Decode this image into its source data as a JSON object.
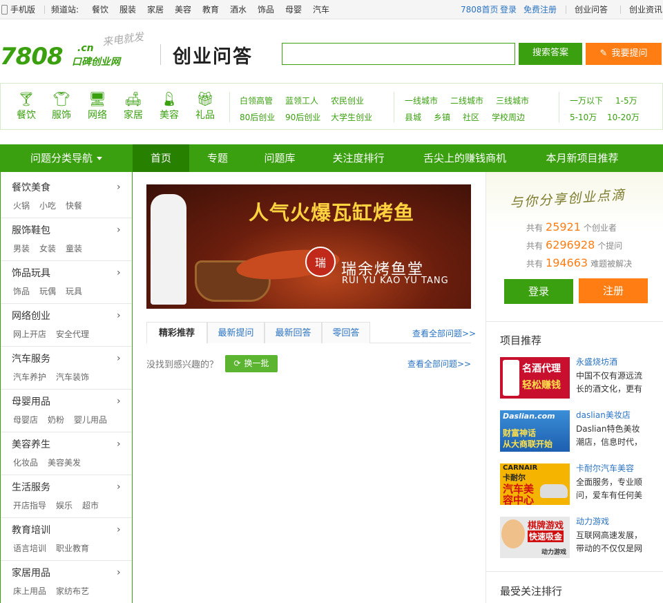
{
  "topbar": {
    "mobile": "手机版",
    "channel_label": "频道站:",
    "channels": [
      "餐饮",
      "服装",
      "家居",
      "美容",
      "教育",
      "酒水",
      "饰品",
      "母婴",
      "汽车"
    ],
    "home": "7808首页",
    "login": "登录",
    "register": "免费注册",
    "qa": "创业问答",
    "news": "创业资讯"
  },
  "header": {
    "logo_main": "7808",
    "logo_cn": ".cn",
    "logo_sub": "口碑创业网",
    "logo_slogan": "来电就发",
    "title": "创业问答",
    "search_button": "搜索答案",
    "ask_button": "我要提问"
  },
  "categories": {
    "icons": [
      {
        "label": "餐饮",
        "icon": "cocktail-icon"
      },
      {
        "label": "服饰",
        "icon": "tshirt-icon"
      },
      {
        "label": "网络",
        "icon": "monitor-icon"
      },
      {
        "label": "家居",
        "icon": "sofa-icon"
      },
      {
        "label": "美容",
        "icon": "lipstick-icon"
      },
      {
        "label": "礼品",
        "icon": "gift-icon"
      }
    ],
    "groups": [
      [
        "白领高管",
        "蓝领工人",
        "农民创业",
        "80后创业",
        "90后创业",
        "大学生创业"
      ],
      [
        "一线城市",
        "二线城市",
        "三线城市",
        "县城",
        "乡镇",
        "社区",
        "学校周边"
      ],
      [
        "一万以下",
        "1-5万",
        "5-10万",
        "10-20万"
      ]
    ]
  },
  "nav": {
    "category_nav": "问题分类导航",
    "items": [
      "首页",
      "专题",
      "问题库",
      "关注度排行",
      "舌尖上的赚钱商机",
      "本月新项目推荐"
    ]
  },
  "sidebar": [
    {
      "title": "餐饮美食",
      "subs": [
        "火锅",
        "小吃",
        "快餐"
      ]
    },
    {
      "title": "服饰鞋包",
      "subs": [
        "男装",
        "女装",
        "童装"
      ]
    },
    {
      "title": "饰品玩具",
      "subs": [
        "饰品",
        "玩偶",
        "玩具"
      ]
    },
    {
      "title": "网络创业",
      "subs": [
        "网上开店",
        "安全代理"
      ]
    },
    {
      "title": "汽车服务",
      "subs": [
        "汽车养护",
        "汽车装饰"
      ]
    },
    {
      "title": "母婴用品",
      "subs": [
        "母婴店",
        "奶粉",
        "婴儿用品"
      ]
    },
    {
      "title": "美容养生",
      "subs": [
        "化妆品",
        "美容美发"
      ]
    },
    {
      "title": "生活服务",
      "subs": [
        "开店指导",
        "娱乐",
        "超市"
      ]
    },
    {
      "title": "教育培训",
      "subs": [
        "语言培训",
        "职业教育"
      ]
    },
    {
      "title": "家居用品",
      "subs": [
        "床上用品",
        "家纺布艺"
      ]
    }
  ],
  "banner": {
    "headline": "人气火爆瓦缸烤鱼",
    "brand": "瑞余烤鱼堂",
    "pinyin": "RUI YU KAO YU TANG",
    "seal": "瑞"
  },
  "tabs": {
    "items": [
      "精彩推荐",
      "最新提问",
      "最新回答",
      "零回答"
    ],
    "view_all": "查看全部问题>>"
  },
  "suggest": {
    "not_found": "没找到感兴趣的？",
    "swap": "换一批",
    "view_all": "查看全部问题>>"
  },
  "welcome": {
    "slogan": "与你分享创业点滴",
    "stats": [
      {
        "pre": "共有",
        "num": "25921",
        "post": "个创业者"
      },
      {
        "pre": "共有",
        "num": "6296928",
        "post": "个提问"
      },
      {
        "pre": "共有",
        "num": "194663",
        "post": "难题被解决"
      }
    ],
    "login": "登录",
    "register": "注册"
  },
  "projects": {
    "heading": "项目推荐",
    "items": [
      {
        "name": "永盛烧坊酒",
        "desc": "中国不仅有源远流长的酒文化，更有",
        "img_lines": [
          "名酒代理",
          "轻松赚钱"
        ]
      },
      {
        "name": "daslian美妆店",
        "desc": "Daslian特色美妆潮店，信息时代，最",
        "img_lines": [
          "Daslian.com",
          "财富神话",
          "从大商联开始"
        ]
      },
      {
        "name": "卡耐尔汽车美容",
        "desc": "全面服务，专业顺问，爱车有任何美",
        "img_lines": [
          "CARNAIR",
          "卡耐尔",
          "汽车美",
          "容中心"
        ]
      },
      {
        "name": "动力游戏",
        "desc": "互联网高速发展，带动的不仅仅是网",
        "img_lines": [
          "棋牌游戏",
          "快速吸金",
          "动力游戏"
        ]
      }
    ]
  },
  "ranking": {
    "heading": "最受关注排行"
  },
  "colors": {
    "brand_green": "#3aa00f",
    "orange": "#ff7d12",
    "link_blue": "#2a73c2"
  }
}
